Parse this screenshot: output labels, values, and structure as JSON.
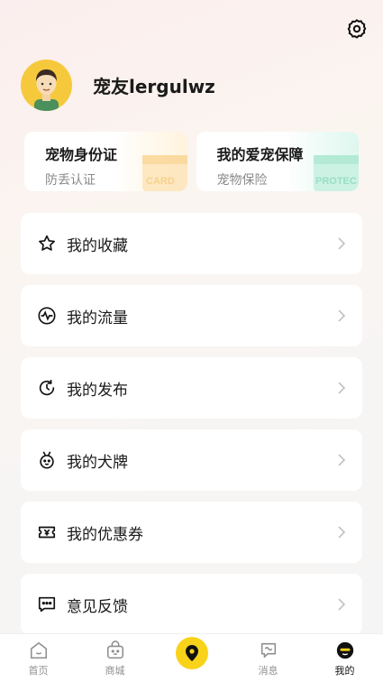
{
  "header": {
    "settings_icon": "gear-icon"
  },
  "profile": {
    "username": "宠友lergulwz",
    "avatar_bg": "#f6c93d"
  },
  "cards": [
    {
      "title": "宠物身份证",
      "subtitle": "防丢认证",
      "art_text": "CARD"
    },
    {
      "title": "我的爱宠保障",
      "subtitle": "宠物保险",
      "art_text": "PROTEC"
    }
  ],
  "menu": [
    {
      "label": "我的收藏",
      "icon": "star-icon"
    },
    {
      "label": "我的流量",
      "icon": "pulse-icon"
    },
    {
      "label": "我的发布",
      "icon": "refresh-icon"
    },
    {
      "label": "我的犬牌",
      "icon": "dog-tag-icon"
    },
    {
      "label": "我的优惠券",
      "icon": "coupon-icon"
    },
    {
      "label": "意见反馈",
      "icon": "feedback-icon"
    }
  ],
  "tabbar": [
    {
      "label": "首页",
      "icon": "home-icon",
      "active": false
    },
    {
      "label": "商城",
      "icon": "shop-icon",
      "active": false
    },
    {
      "label": "",
      "icon": "location-icon",
      "active": false
    },
    {
      "label": "消息",
      "icon": "message-icon",
      "active": false
    },
    {
      "label": "我的",
      "icon": "profile-icon",
      "active": true
    }
  ],
  "colors": {
    "accent": "#f8d31a",
    "text": "#1a1a1a",
    "muted": "#8a8a8a"
  }
}
